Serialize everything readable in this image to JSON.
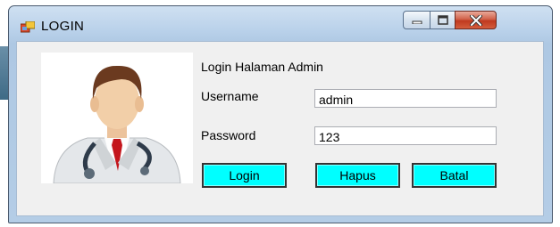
{
  "window": {
    "title": "LOGIN"
  },
  "form": {
    "heading": "Login Halaman Admin",
    "username_label": "Username",
    "username_value": "admin",
    "password_label": "Password",
    "password_value": "123"
  },
  "buttons": {
    "login": "Login",
    "hapus": "Hapus",
    "batal": "Batal"
  },
  "icons": {
    "app": "form-app-icon",
    "minimize": "minimize-icon",
    "maximize": "maximize-icon",
    "close": "close-icon",
    "photo": "doctor-avatar"
  },
  "colors": {
    "button_bg": "#00ffff",
    "close_button": "#c0391f",
    "titlebar": "#b9d1ea"
  }
}
